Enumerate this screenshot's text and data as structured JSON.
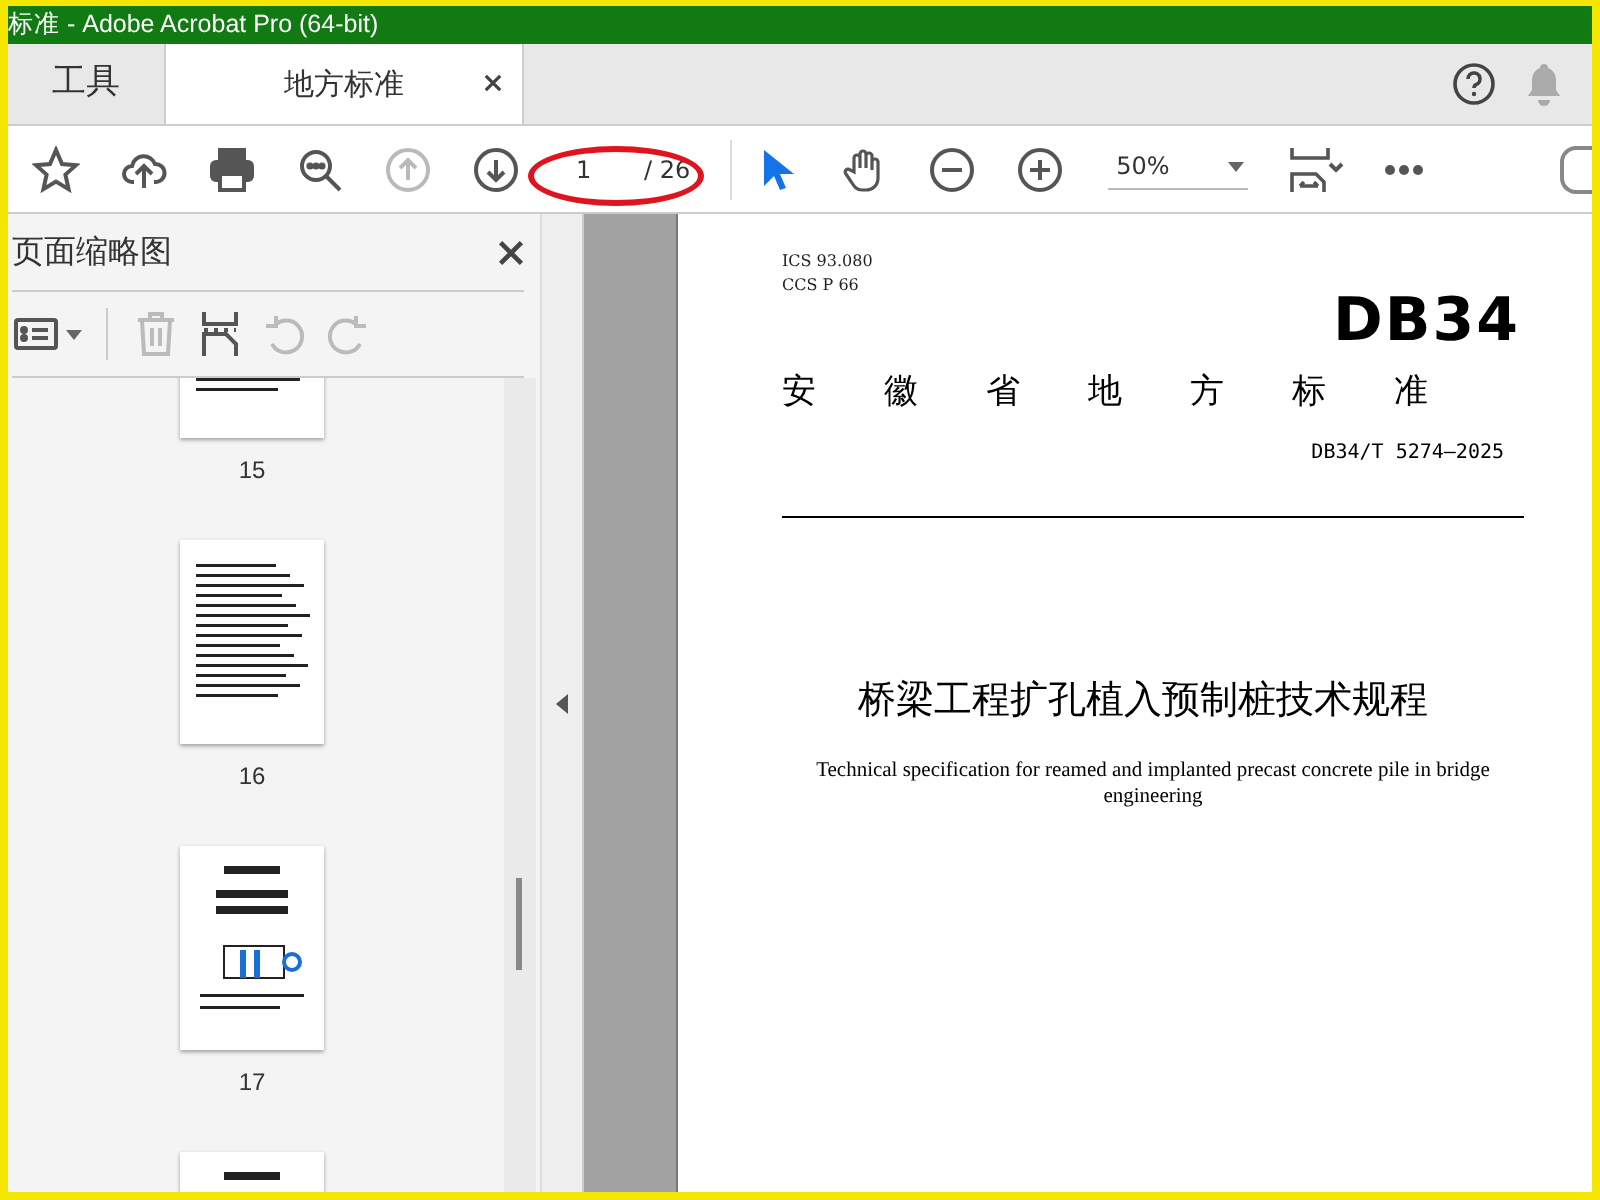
{
  "window": {
    "title": "标准 - Adobe Acrobat Pro (64-bit)"
  },
  "tabs": [
    {
      "label": "工具",
      "selected": false
    },
    {
      "label": "地方标准",
      "selected": true
    }
  ],
  "toolbar": {
    "nav_tools": [
      {
        "kind": "star",
        "disabled": false,
        "selected": false
      },
      {
        "kind": "upload",
        "disabled": false,
        "selected": false
      },
      {
        "kind": "print",
        "disabled": false,
        "selected": false
      },
      {
        "kind": "search",
        "disabled": false,
        "selected": false
      },
      {
        "kind": "up",
        "disabled": true,
        "selected": false
      },
      {
        "kind": "down",
        "disabled": false,
        "selected": false
      }
    ],
    "page_number": "1",
    "page_total": "/ 26",
    "view_tools": [
      {
        "kind": "pointer",
        "disabled": false,
        "selected": true
      },
      {
        "kind": "hand",
        "disabled": false,
        "selected": false
      },
      {
        "kind": "zoomout",
        "disabled": false,
        "selected": false
      },
      {
        "kind": "zoomin",
        "disabled": false,
        "selected": false
      }
    ],
    "zoom": "50%",
    "layout_tools": [
      {
        "kind": "fit",
        "disabled": false,
        "selected": false
      },
      {
        "kind": "more",
        "disabled": false,
        "selected": false
      }
    ]
  },
  "thumbnails_panel": {
    "title": "页面缩略图",
    "tools": [
      {
        "kind": "options",
        "disabled": false
      },
      {
        "kind": "trash",
        "disabled": true
      },
      {
        "kind": "extract",
        "disabled": false
      },
      {
        "kind": "undo",
        "disabled": true
      },
      {
        "kind": "redo",
        "disabled": true
      }
    ],
    "pages": [
      {
        "label": "15",
        "kind": "text"
      },
      {
        "label": "16",
        "kind": "text"
      },
      {
        "label": "17",
        "kind": "diagram"
      },
      {
        "kind": "diagram"
      }
    ]
  },
  "document": {
    "ics": "ICS  93.080",
    "ccs": "CCS  P 66",
    "logo": "DB34",
    "issuer": "安徽省地方标准",
    "number": "DB34/T 5274—2025",
    "title": "桥梁工程扩孔植入预制桩技术规程",
    "subtitle": "Technical specification for reamed and implanted precast concrete pile in bridge engineering"
  }
}
